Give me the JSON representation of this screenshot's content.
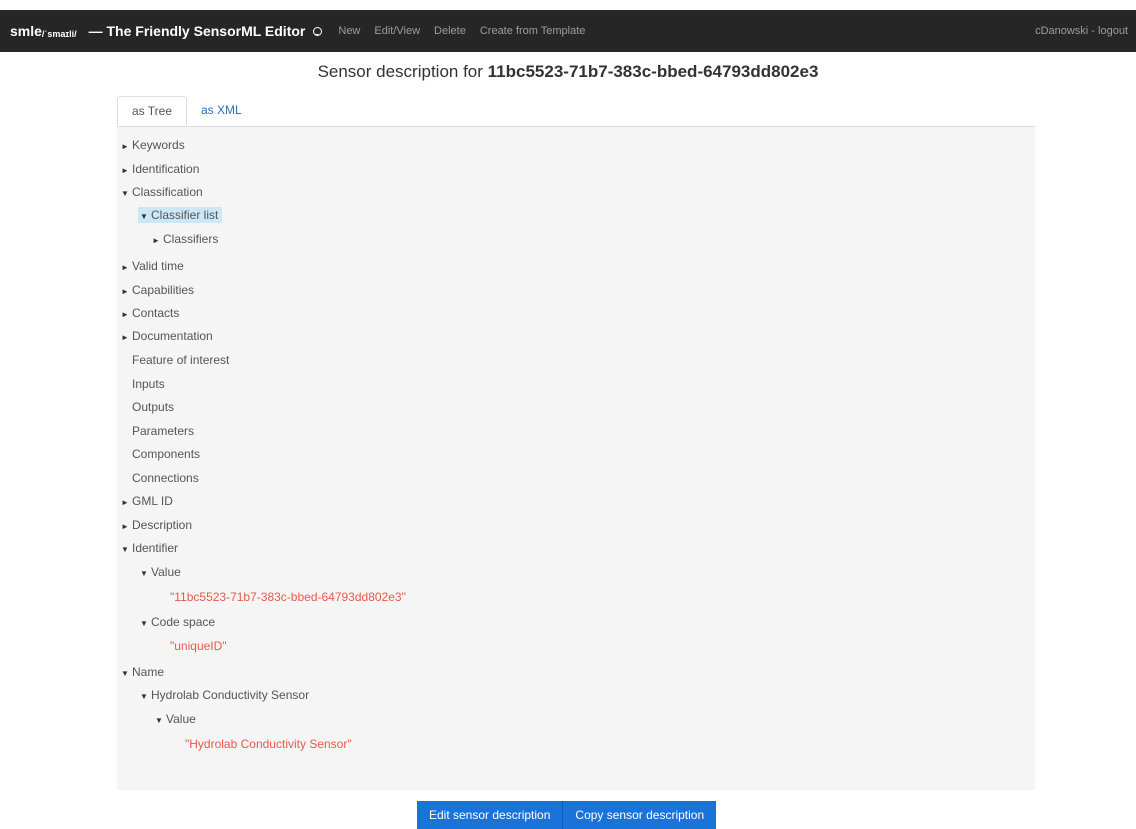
{
  "navbar": {
    "brand": "smle",
    "brand_sub": "/ˈsmaɪli/",
    "brand_title": "— The Friendly SensorML Editor",
    "links": [
      "New",
      "Edit/View",
      "Delete",
      "Create from Template"
    ],
    "user": "cDanowski - logout"
  },
  "heading": {
    "prefix": "Sensor description for ",
    "id": "11bc5523-71b7-383c-bbed-64793dd802e3"
  },
  "tabs": [
    "as Tree",
    "as XML"
  ],
  "tree": [
    {
      "label": "Keywords",
      "arrow": "►"
    },
    {
      "label": "Identification",
      "arrow": "►"
    },
    {
      "label": "Classification",
      "arrow": "▼"
    },
    {
      "label": "Classifier list",
      "arrow": "▼"
    },
    {
      "label": "Classifiers",
      "arrow": "►"
    },
    {
      "label": "Valid time",
      "arrow": "►"
    },
    {
      "label": "Capabilities",
      "arrow": "►"
    },
    {
      "label": "Contacts",
      "arrow": "►"
    },
    {
      "label": "Documentation",
      "arrow": "►"
    },
    {
      "label": "Feature of interest",
      "arrow": ""
    },
    {
      "label": "Inputs",
      "arrow": ""
    },
    {
      "label": "Outputs",
      "arrow": ""
    },
    {
      "label": "Parameters",
      "arrow": ""
    },
    {
      "label": "Components",
      "arrow": ""
    },
    {
      "label": "Connections",
      "arrow": ""
    },
    {
      "label": "GML ID",
      "arrow": "►"
    },
    {
      "label": "Description",
      "arrow": "►"
    },
    {
      "label": "Identifier",
      "arrow": "▼"
    },
    {
      "label": "Value",
      "arrow": "▼"
    },
    {
      "label": "\"11bc5523-71b7-383c-bbed-64793dd802e3\"",
      "arrow": ""
    },
    {
      "label": "Code space",
      "arrow": "▼"
    },
    {
      "label": "\"uniqueID\"",
      "arrow": ""
    },
    {
      "label": "Name",
      "arrow": "▼"
    },
    {
      "label": "Hydrolab Conductivity Sensor",
      "arrow": "▼"
    },
    {
      "label": "Value",
      "arrow": "▼"
    },
    {
      "label": "\"Hydrolab Conductivity Sensor\"",
      "arrow": ""
    }
  ],
  "buttons": {
    "edit": "Edit sensor description",
    "copy": "Copy sensor description"
  },
  "colors": {
    "navbar_bg": "#262626",
    "link_blue": "#2a6ebb",
    "string_value": "#e8594b",
    "button_blue": "#1a73d9",
    "selection": "#cce8f8"
  }
}
